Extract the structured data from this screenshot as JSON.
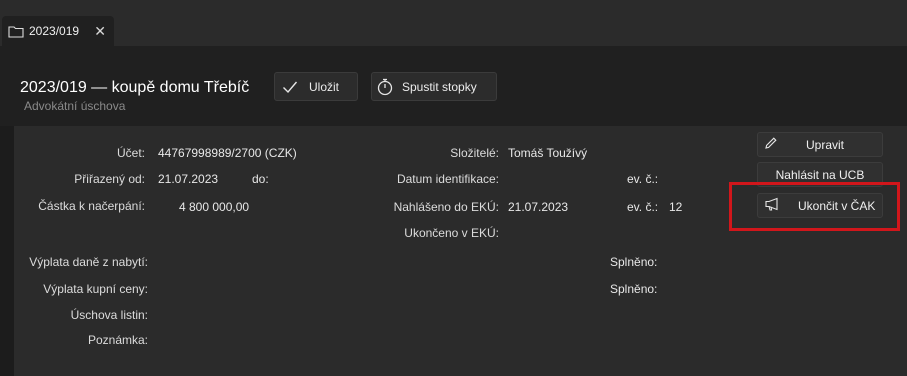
{
  "tab": {
    "title": "2023/019",
    "close": "✕"
  },
  "header": {
    "title": "2023/019 — koupě domu Třebíč",
    "subtitle": "Advokátní úschova",
    "save_label": "Uložit",
    "stopwatch_label": "Spustit stopky"
  },
  "fields": {
    "ucet_label": "Účet:",
    "ucet_value": "44767998989/2700 (CZK)",
    "prirazeny_label": "Přiřazený od:",
    "prirazeny_value": "21.07.2023",
    "do_label": "do:",
    "castka_label": "Částka k načerpání:",
    "castka_value": "4 800 000,00",
    "slozitele_label": "Složitelé:",
    "slozitele_value": "Tomáš Toužívý",
    "datum_ident_label": "Datum identifikace:",
    "ev1_label": "ev. č.:",
    "nahlaseno_label": "Nahlášeno do EKÚ:",
    "nahlaseno_value": "21.07.2023",
    "ev2_label": "ev. č.:",
    "ev2_value": "12",
    "ukonceno_label": "Ukončeno v EKÚ:",
    "vyplata_dane_label": "Výplata daně z nabytí:",
    "splneno1_label": "Splněno:",
    "vyplata_kupni_label": "Výplata kupní ceny:",
    "splneno2_label": "Splněno:",
    "uschova_label": "Úschova listin:",
    "poznamka_label": "Poznámka:"
  },
  "actions": {
    "upravit": "Upravit",
    "nahlasit": "Nahlásit na UCB",
    "ukoncit": "Ukončit v ČAK"
  },
  "icons": {
    "tab": "folder-icon",
    "save": "checkmark-icon",
    "stopwatch": "stopwatch-icon",
    "edit": "pencil-icon",
    "megaphone": "megaphone-icon"
  },
  "colors": {
    "background": "#1c1c1c",
    "panel": "#2b2b2b",
    "highlight": "#d1161b"
  }
}
